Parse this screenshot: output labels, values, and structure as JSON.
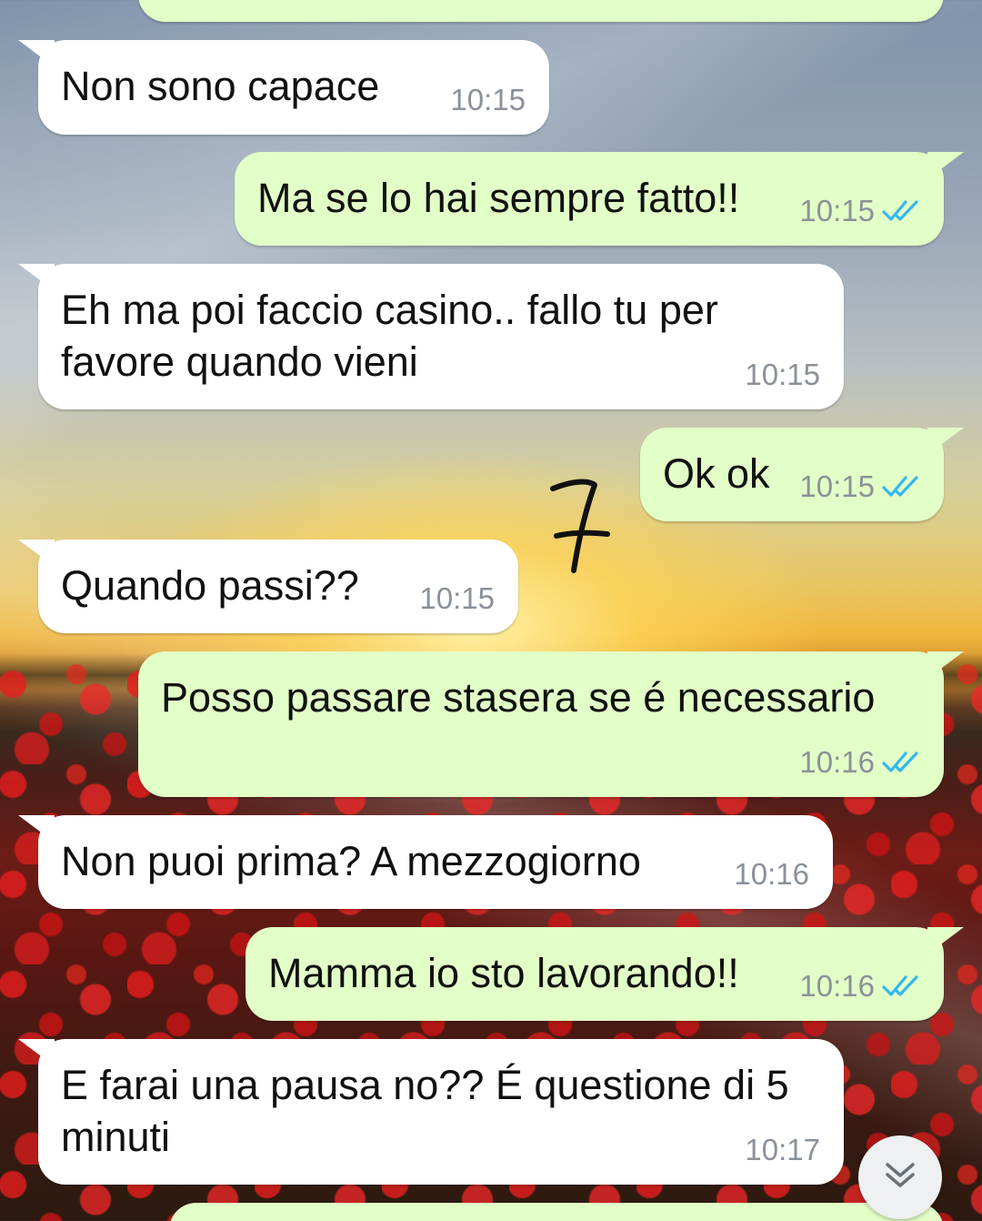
{
  "theme": {
    "incoming_bubble_color": "#ffffff",
    "outgoing_bubble_color": "#e2ffc7",
    "time_color": "#8a9199",
    "read_ticks_color": "#34b7f1"
  },
  "messages": [
    {
      "direction": "in",
      "text": "Non sono capace",
      "time": "10:15"
    },
    {
      "direction": "out",
      "text": "Ma se lo hai sempre fatto!!",
      "time": "10:15",
      "status_icon": "double-check-read-icon"
    },
    {
      "direction": "in",
      "text": "Eh ma poi faccio casino.. fallo tu per\nfavore quando vieni",
      "time": "10:15"
    },
    {
      "direction": "out",
      "text": "Ok ok",
      "time": "10:15",
      "status_icon": "double-check-read-icon"
    },
    {
      "direction": "in",
      "text": "Quando passi??",
      "time": "10:15"
    },
    {
      "direction": "out",
      "text": "Posso passare stasera se é necessario",
      "time": "10:16",
      "status_icon": "double-check-read-icon"
    },
    {
      "direction": "in",
      "text": "Non puoi prima? A mezzogiorno",
      "time": "10:16"
    },
    {
      "direction": "out",
      "text": "Mamma io sto lavorando!!",
      "time": "10:16",
      "status_icon": "double-check-read-icon"
    },
    {
      "direction": "in",
      "text": "E farai una pausa no?? É questione di 5\nminuti",
      "time": "10:17"
    }
  ],
  "annotation": {
    "text": "7"
  },
  "scroll_button": {
    "icon": "double-chevron-down-icon"
  }
}
